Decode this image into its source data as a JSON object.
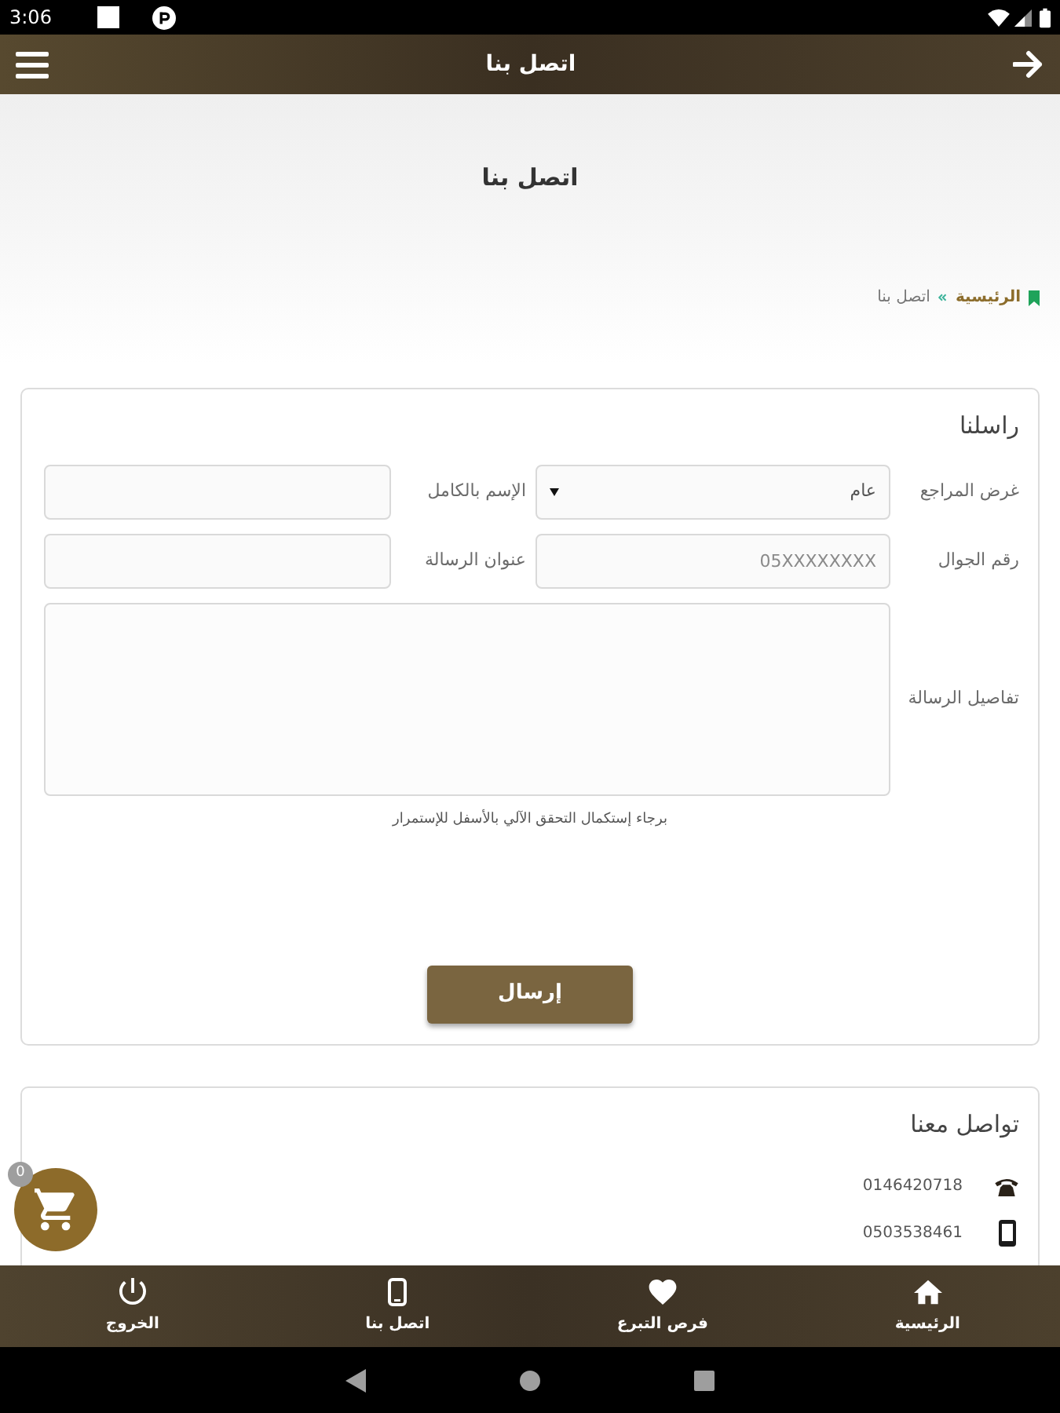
{
  "status_bar": {
    "time": "3:06"
  },
  "app_bar": {
    "title": "اتصل بنا"
  },
  "hero": {
    "title": "اتصل بنا"
  },
  "breadcrumb": [
    {
      "kind": "link",
      "label": "الرئيسية"
    },
    {
      "kind": "current",
      "label": "اتصل بنا"
    }
  ],
  "contact_form": {
    "title": "راسلنا",
    "fields": [
      {
        "kind": "select",
        "label": "غرض المراجع",
        "value": "عام"
      },
      {
        "kind": "text",
        "label": "الإسم بالكامل"
      },
      {
        "kind": "text",
        "label": "رقم الجوال",
        "placeholder": "05XXXXXXXX"
      },
      {
        "kind": "text",
        "label": "عنوان الرسالة"
      },
      {
        "kind": "textarea",
        "label": "تفاصيل الرسالة"
      }
    ],
    "note": "برجاء إستكمال التحقق الآلي بالأسفل للإستمرار",
    "submit_button": "إرسال"
  },
  "contact_info": {
    "title": "تواصل معنا",
    "items": [
      {
        "kind": "landline",
        "value": "0146420718"
      },
      {
        "kind": "mobile",
        "value": "0503538461"
      }
    ]
  },
  "cart": {
    "count": "0"
  },
  "bottom_nav": [
    {
      "kind": "home",
      "label": "الرئيسية"
    },
    {
      "kind": "donations",
      "label": "فرص التبرع"
    },
    {
      "kind": "contact",
      "label": "اتصل بنا"
    },
    {
      "kind": "logout",
      "label": "الخروج"
    }
  ]
}
